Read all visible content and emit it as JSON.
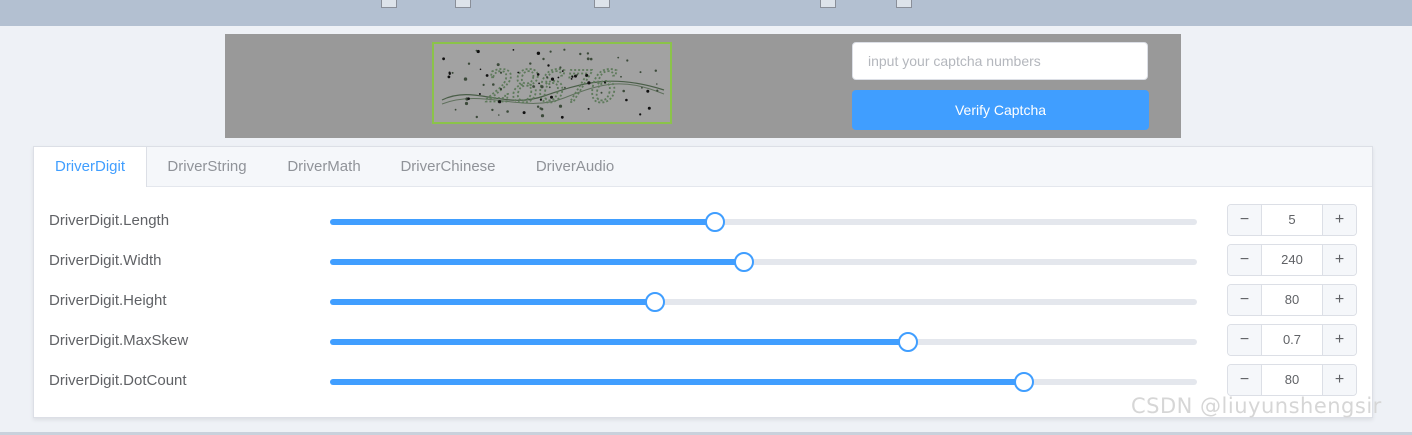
{
  "captcha": {
    "placeholder": "input your captcha numbers",
    "verify_label": "Verify Captcha",
    "image_text": "28676"
  },
  "tabs": [
    {
      "label": "DriverDigit",
      "active": true
    },
    {
      "label": "DriverString",
      "active": false
    },
    {
      "label": "DriverMath",
      "active": false
    },
    {
      "label": "DriverChinese",
      "active": false
    },
    {
      "label": "DriverAudio",
      "active": false
    }
  ],
  "settings": [
    {
      "label": "DriverDigit.Length",
      "value": "5",
      "slider_fraction": 0.444
    },
    {
      "label": "DriverDigit.Width",
      "value": "240",
      "slider_fraction": 0.478
    },
    {
      "label": "DriverDigit.Height",
      "value": "80",
      "slider_fraction": 0.375
    },
    {
      "label": "DriverDigit.MaxSkew",
      "value": "0.7",
      "slider_fraction": 0.667
    },
    {
      "label": "DriverDigit.DotCount",
      "value": "80",
      "slider_fraction": 0.8
    }
  ],
  "stepper": {
    "minus": "−",
    "plus": "+"
  },
  "watermark": "CSDN @liuyunshengsir",
  "colors": {
    "accent": "#409eff",
    "header": "#b3c0d1",
    "captcha_bg": "#999999",
    "captcha_border": "#8bc34a"
  }
}
